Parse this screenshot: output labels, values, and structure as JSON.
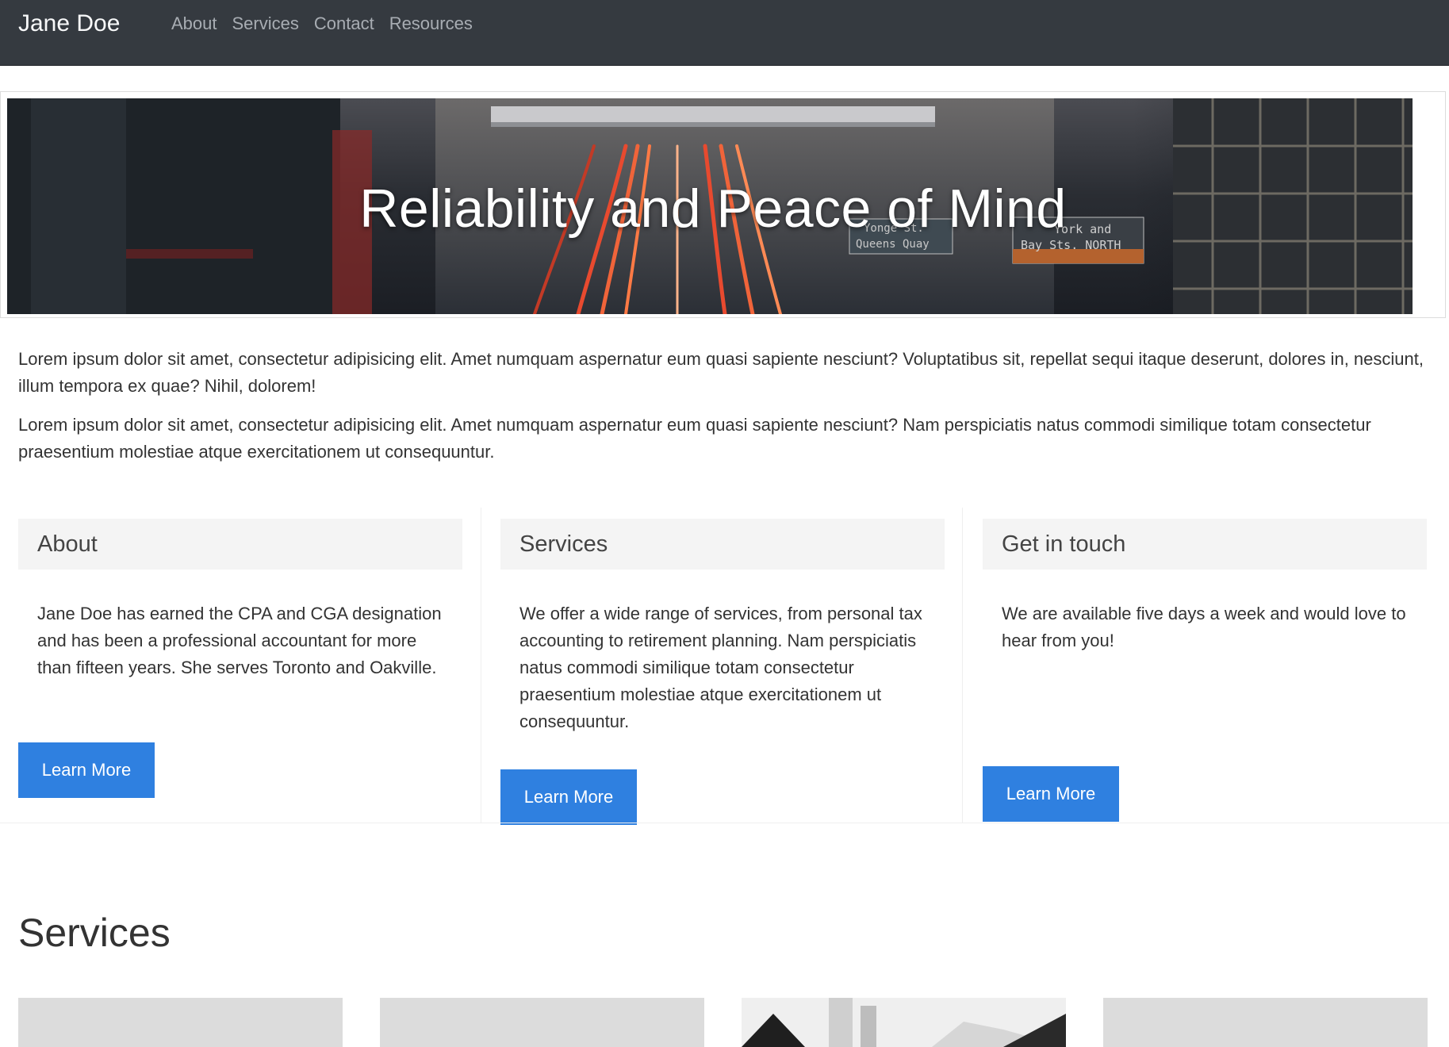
{
  "navbar": {
    "brand": "Jane Doe",
    "links": [
      "About",
      "Services",
      "Contact",
      "Resources"
    ]
  },
  "hero": {
    "title": "Reliability and Peace of Mind",
    "signs": [
      "Yonge St.",
      "Queens Quay",
      "York and",
      "Bay Sts. NORTH"
    ]
  },
  "intro": {
    "paragraphs": [
      "Lorem ipsum dolor sit amet, consectetur adipisicing elit. Amet numquam aspernatur eum quasi sapiente nesciunt? Voluptatibus sit, repellat sequi itaque deserunt, dolores in, nesciunt, illum tempora ex quae? Nihil, dolorem!",
      "Lorem ipsum dolor sit amet, consectetur adipisicing elit. Amet numquam aspernatur eum quasi sapiente nesciunt? Nam perspiciatis natus commodi similique totam consectetur praesentium molestiae atque exercitationem ut consequuntur."
    ]
  },
  "cards": [
    {
      "title": "About",
      "text": "Jane Doe has earned the CPA and CGA designation and has been a professional accountant for more than fifteen years. She serves Toronto and Oakville.",
      "button": "Learn More"
    },
    {
      "title": "Services",
      "text": "We offer a wide range of services, from personal tax accounting to retirement planning. Nam perspiciatis natus commodi similique totam consectetur praesentium molestiae atque exercitationem ut consequuntur.",
      "button": "Learn More"
    },
    {
      "title": "Get in touch",
      "text": "We are available five days a week and would love to hear from you!",
      "button": "Learn More"
    }
  ],
  "services": {
    "title": "Services",
    "thumbnails": [
      "placeholder",
      "placeholder",
      "photo",
      "placeholder"
    ]
  },
  "colors": {
    "navbar_bg": "#353a40",
    "button_bg": "#2f80e0",
    "card_header_bg": "#f4f4f4"
  }
}
